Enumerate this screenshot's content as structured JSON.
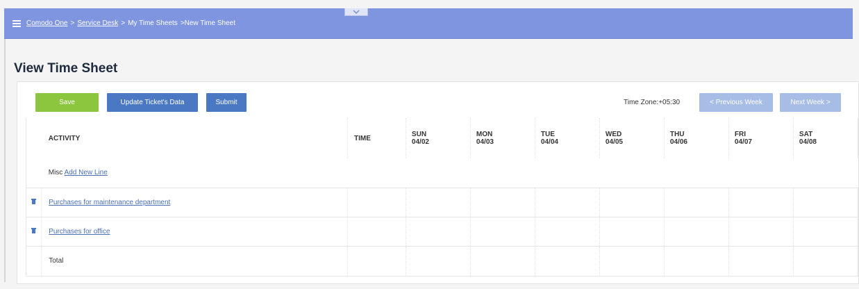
{
  "breadcrumb": {
    "items": [
      "Comodo One",
      "Service Desk",
      "My Time Sheets",
      "New Time Sheet"
    ]
  },
  "page": {
    "title": "View Time Sheet"
  },
  "toolbar": {
    "save_label": "Save",
    "update_label": "Update Ticket's Data",
    "submit_label": "Submit",
    "timezone_text": "Time Zone:+05:30",
    "prev_week_label": "< Previous Week",
    "next_week_label": "Next Week >"
  },
  "colors": {
    "topbar": "#7f95e0",
    "save": "#8cc63f",
    "primary": "#4a78c2",
    "disabled_nav": "#a8bde6"
  },
  "table": {
    "activity_header": "ACTIVITY",
    "time_header": "TIME",
    "days": [
      {
        "day": "SUN",
        "date": "04/02"
      },
      {
        "day": "MON",
        "date": "04/03"
      },
      {
        "day": "TUE",
        "date": "04/04"
      },
      {
        "day": "WED",
        "date": "04/05"
      },
      {
        "day": "THU",
        "date": "04/06"
      },
      {
        "day": "FRI",
        "date": "04/07"
      },
      {
        "day": "SAT",
        "date": "04/08"
      }
    ],
    "misc_label": "Misc",
    "add_line_label": "Add New Line",
    "rows": [
      {
        "activity": "Purchases for maintenance department",
        "icon": "trash-icon"
      },
      {
        "activity": "Purchases for office",
        "icon": "trash-icon"
      }
    ],
    "total_label": "Total"
  }
}
